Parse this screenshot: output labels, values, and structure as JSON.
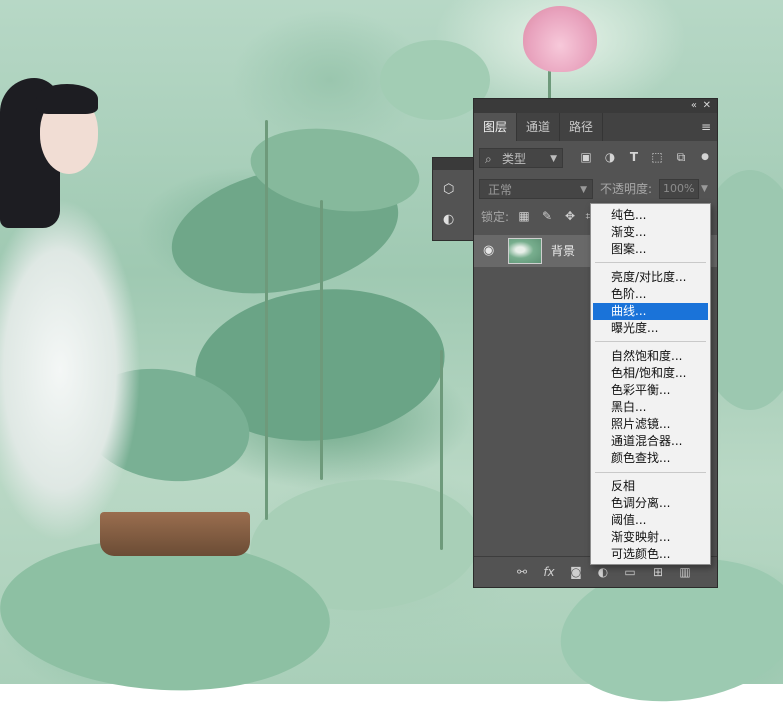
{
  "panel": {
    "collapse_icon": "«",
    "close_icon": "✕",
    "tabs": [
      {
        "label": "图层",
        "active": true
      },
      {
        "label": "通道",
        "active": false
      },
      {
        "label": "路径",
        "active": false
      }
    ],
    "menu_icon": "≡",
    "filter": {
      "label": "类型"
    },
    "blend_mode": "正常",
    "opacity_label": "不透明度:",
    "opacity_value": "100%",
    "lock_label": "锁定:",
    "layer": {
      "name": "背景",
      "visible": true
    }
  },
  "adjustment_menu": {
    "groups": [
      [
        "纯色...",
        "渐变...",
        "图案..."
      ],
      [
        "亮度/对比度...",
        "色阶...",
        "曲线...",
        "曝光度..."
      ],
      [
        "自然饱和度...",
        "色相/饱和度...",
        "色彩平衡...",
        "黑白...",
        "照片滤镜...",
        "通道混合器...",
        "颜色查找..."
      ],
      [
        "反相",
        "色调分离...",
        "阈值...",
        "渐变映射...",
        "可选颜色..."
      ]
    ],
    "highlighted": "曲线..."
  },
  "bottom_icons": [
    "link-icon",
    "fx-icon",
    "mask-icon",
    "adjustment-icon",
    "folder-icon",
    "new-layer-icon",
    "trash-icon"
  ],
  "colors": {
    "panel_bg": "#535353",
    "menu_highlight": "#1a73d9",
    "selected_layer": "#696969"
  }
}
